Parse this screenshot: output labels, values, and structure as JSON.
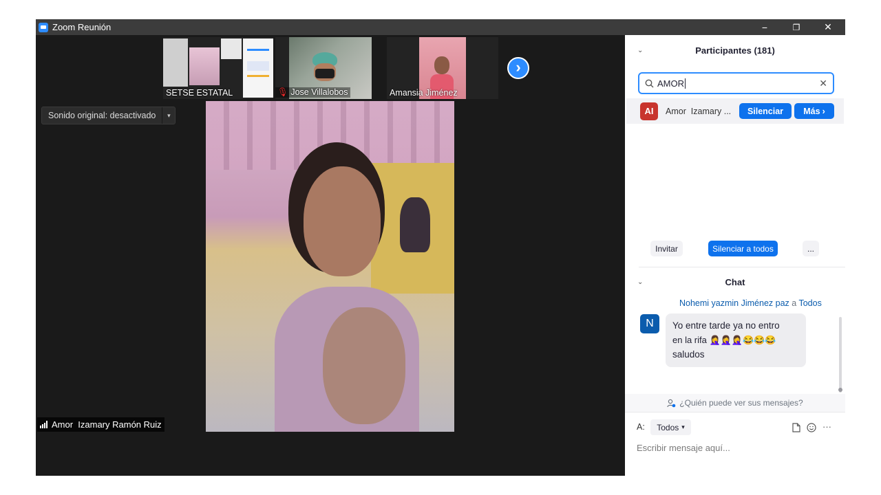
{
  "titlebar": {
    "title": "Zoom Reunión",
    "minimize": "−",
    "restore": "❐",
    "close": "✕"
  },
  "gallery": {
    "thumbnails": [
      {
        "name": "SETSE ESTATAL",
        "muted": false
      },
      {
        "name": "Jose Villalobos",
        "muted": true
      },
      {
        "name": "Amansia Jiménez",
        "muted": false
      }
    ],
    "next_icon": "›"
  },
  "sound_toggle": {
    "label": "Sonido original: desactivado",
    "caret": "▾"
  },
  "active_speaker": {
    "name": "Amor  Izamary Ramón Ruiz"
  },
  "participants": {
    "header": "Participantes (181)",
    "collapse_icon": "⌄",
    "search_value": "AMOR",
    "clear_icon": "✕",
    "results": [
      {
        "initials": "AI",
        "name": "Amor  Izamary ...",
        "avatar_color": "#c8342d",
        "mute_label": "Silenciar",
        "more_label": "Más"
      }
    ],
    "invite_label": "Invitar",
    "mute_all_label": "Silenciar a todos",
    "more_options_label": "..."
  },
  "chat": {
    "header": "Chat",
    "collapse_icon": "⌄",
    "messages": [
      {
        "initial": "N",
        "avatar_color": "#0b5cad",
        "sender": "Nohemi yazmin Jiménez paz",
        "connector": "a",
        "recipient": "Todos",
        "text_line1": "Yo entre tarde ya no entro",
        "text_line2": "en la rifa 🤦‍♀️🤦‍♀️🤦‍♀️😂😂😂",
        "text_line3": "saludos"
      }
    ],
    "privacy_text": "¿Quién puede ver sus mensajes?",
    "to_label": "A:",
    "recipient_select": "Todos",
    "input_placeholder": "Escribir mensaje aquí...",
    "more_icon": "···"
  },
  "colors": {
    "accent": "#0e72ed",
    "link": "#0b5cad",
    "titlebar": "#3c3c3c",
    "video_bg": "#1a1a1a"
  }
}
